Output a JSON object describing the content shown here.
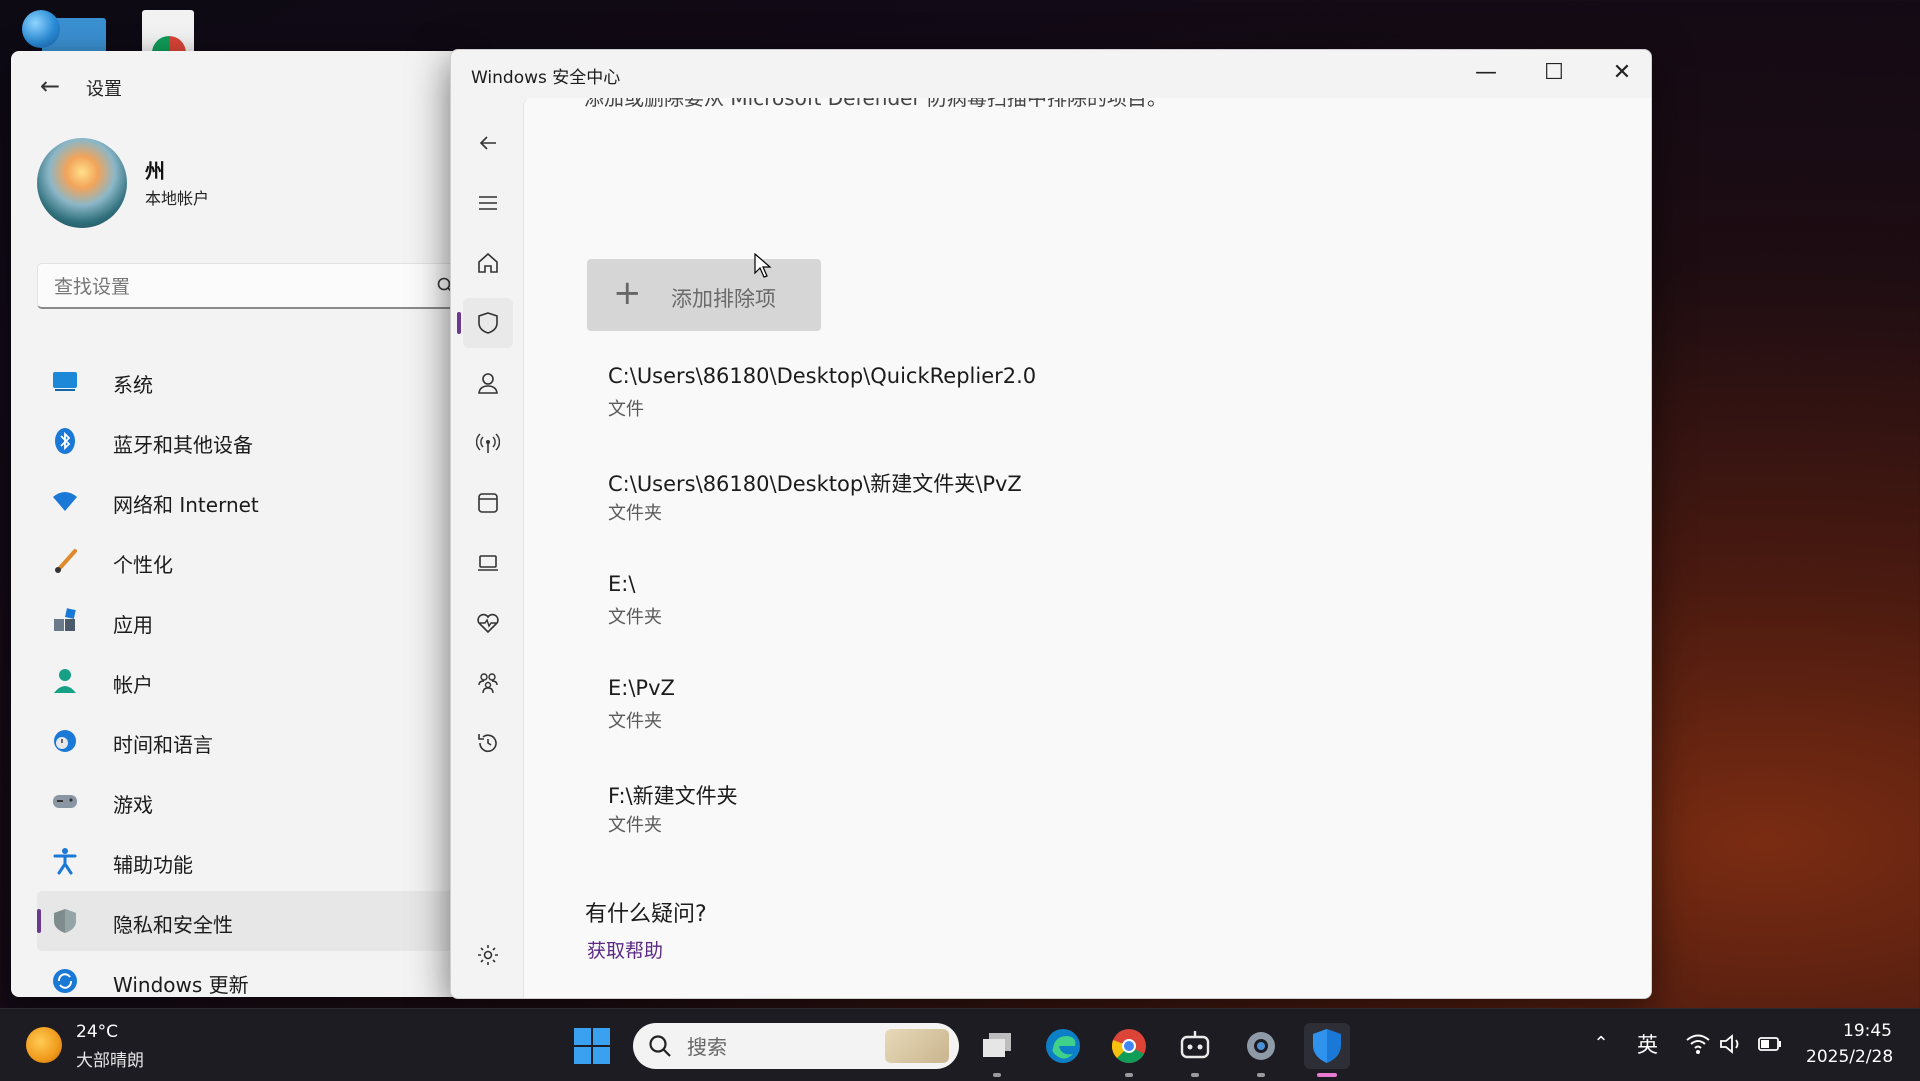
{
  "settings": {
    "title": "设置",
    "user": {
      "name": "州",
      "account_type": "本地帐户"
    },
    "search_placeholder": "查找设置",
    "nav": [
      {
        "label": "系统",
        "icon": "system-icon"
      },
      {
        "label": "蓝牙和其他设备",
        "icon": "bluetooth-icon"
      },
      {
        "label": "网络和 Internet",
        "icon": "wifi-icon"
      },
      {
        "label": "个性化",
        "icon": "brush-icon"
      },
      {
        "label": "应用",
        "icon": "apps-icon"
      },
      {
        "label": "帐户",
        "icon": "account-icon"
      },
      {
        "label": "时间和语言",
        "icon": "globe-clock-icon"
      },
      {
        "label": "游戏",
        "icon": "gamepad-icon"
      },
      {
        "label": "辅助功能",
        "icon": "accessibility-icon"
      },
      {
        "label": "隐私和安全性",
        "icon": "shield-icon",
        "active": true
      },
      {
        "label": "Windows 更新",
        "icon": "update-icon"
      }
    ]
  },
  "security": {
    "window_title": "Windows 安全中心",
    "cut_off_text": "添加或删除要从 Microsoft Defender 防病毒扫描中排除的项目。",
    "add_button": "添加排除项",
    "exclusions": [
      {
        "path": "C:\\Users\\86180\\Desktop\\QuickReplier2.0",
        "type": "文件"
      },
      {
        "path": "C:\\Users\\86180\\Desktop\\新建文件夹\\PvZ",
        "type": "文件夹"
      },
      {
        "path": "E:\\",
        "type": "文件夹"
      },
      {
        "path": "E:\\PvZ",
        "type": "文件夹"
      },
      {
        "path": "F:\\新建文件夹",
        "type": "文件夹"
      }
    ],
    "faq_title": "有什么疑问?",
    "faq_link": "获取帮助",
    "accent_color": "#5b2a86"
  },
  "taskbar": {
    "weather": {
      "temp": "24°C",
      "desc": "大部晴朗"
    },
    "search_placeholder": "搜索",
    "language": "英",
    "time": "19:45",
    "date": "2025/2/28"
  }
}
